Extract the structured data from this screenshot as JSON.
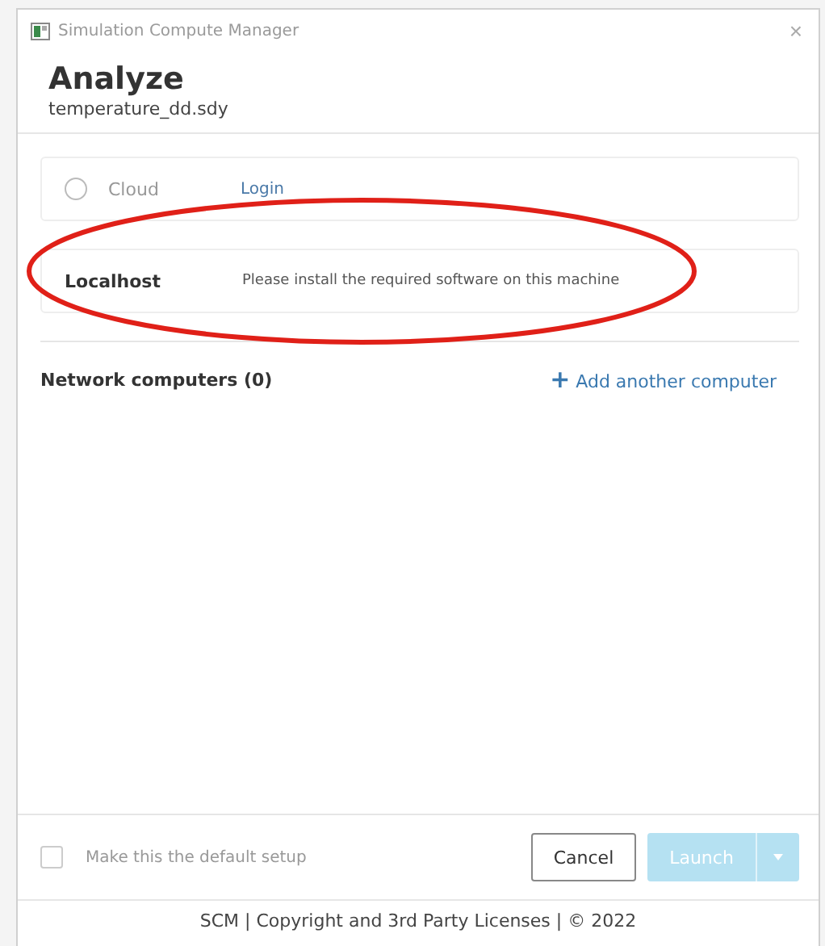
{
  "window": {
    "title": "Simulation Compute Manager",
    "close": "×"
  },
  "header": {
    "title": "Analyze",
    "subtitle": "temperature_dd.sdy"
  },
  "options": [
    {
      "kind": "radio",
      "name": "Cloud",
      "selected": false,
      "disabled": true,
      "link": "Login"
    },
    {
      "kind": "plain",
      "name": "Localhost",
      "message": "Please install the required software on this machine"
    }
  ],
  "network": {
    "label": "Network computers (0)",
    "add_icon": "+",
    "add_link": "Add another computer"
  },
  "annotation": {
    "kind": "ellipse"
  },
  "footer": {
    "default_checkbox": {
      "label": "Make this the default setup",
      "checked": false,
      "disabled": true
    },
    "buttons": [
      {
        "kind": "secondary",
        "label": "Cancel",
        "disabled": false
      },
      {
        "kind": "split",
        "label": "Launch",
        "disabled": true
      }
    ],
    "legal": "SCM | Copyright and 3rd Party Licenses | © 2022"
  }
}
